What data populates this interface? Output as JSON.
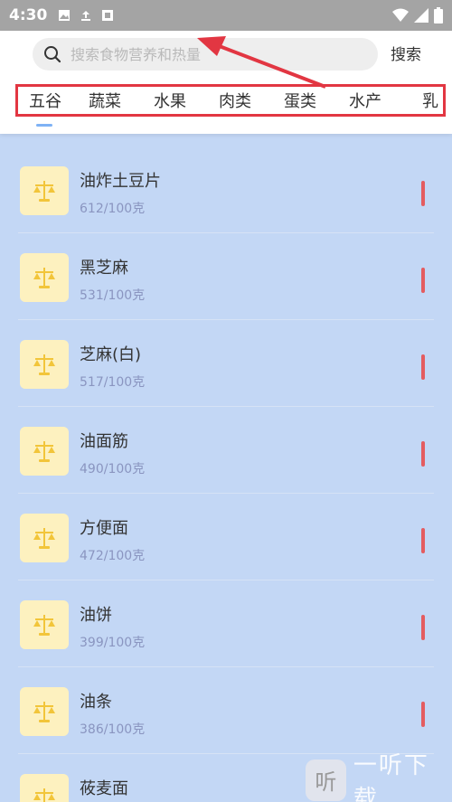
{
  "status": {
    "time": "4:30"
  },
  "search": {
    "placeholder": "搜索食物营养和热量",
    "button_label": "搜索"
  },
  "tabs": [
    "五谷",
    "蔬菜",
    "水果",
    "肉类",
    "蛋类",
    "水产",
    "乳"
  ],
  "foods": [
    {
      "name": "油炸土豆片",
      "calories": "612/100克"
    },
    {
      "name": "黑芝麻",
      "calories": "531/100克"
    },
    {
      "name": "芝麻(白)",
      "calories": "517/100克"
    },
    {
      "name": "油面筋",
      "calories": "490/100克"
    },
    {
      "name": "方便面",
      "calories": "472/100克"
    },
    {
      "name": "油饼",
      "calories": "399/100克"
    },
    {
      "name": "油条",
      "calories": "386/100克"
    },
    {
      "name": "莜麦面",
      "calories": ""
    }
  ],
  "watermark": {
    "text": "一听下载",
    "logo_glyph": "听"
  },
  "colors": {
    "accent_red": "#e23642",
    "bar_red": "#e45c60",
    "icon_bg": "#fdf1bf",
    "icon_gold": "#f2c53a",
    "list_bg": "#c3d7f5"
  }
}
